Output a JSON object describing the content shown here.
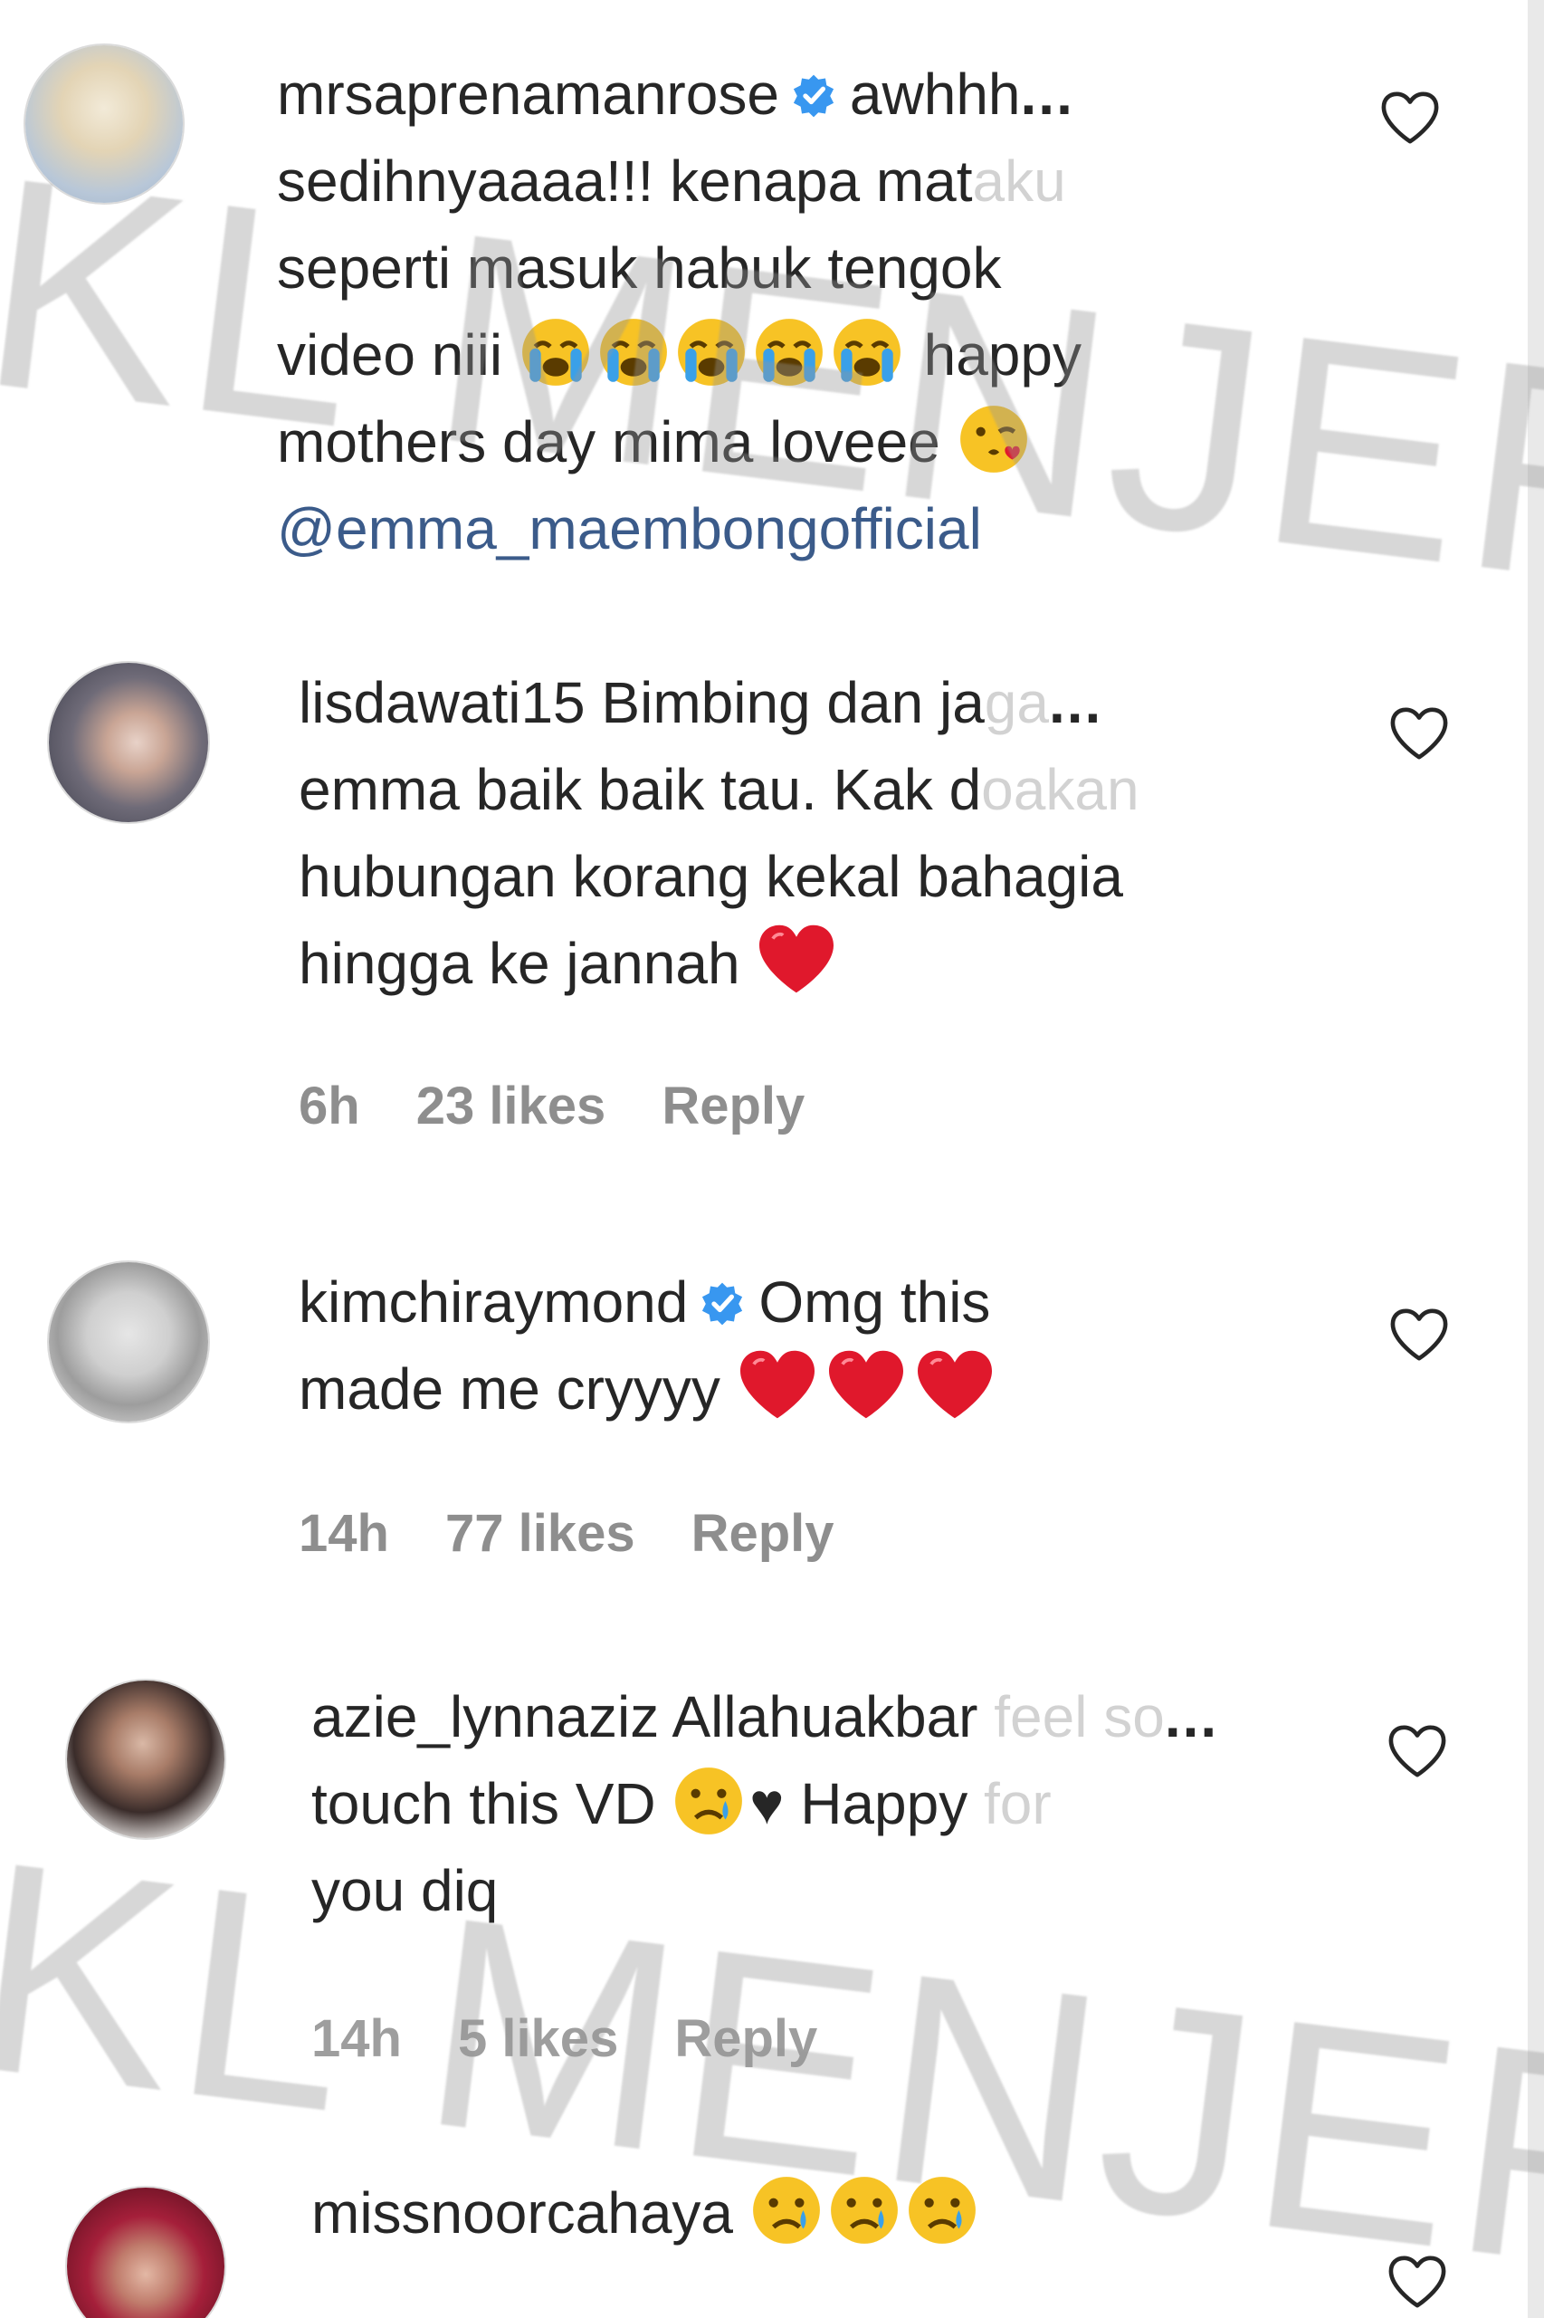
{
  "watermark": "KL MENJERIT",
  "more_label": "...",
  "colors": {
    "verified": "#3897f0",
    "mention": "#3b5b8a",
    "meta": "#8e8e8e",
    "heart_red": "#e0182c"
  },
  "comments": [
    {
      "username": "mrsaprenamanrose",
      "verified": true,
      "lines": [
        "awhhh",
        "sedihnyaaaa!!! kenapa mat",
        "aku",
        "sepe",
        "rti masuk habuk tengok",
        "video niii",
        "happy",
        "mothers day mima loveee"
      ],
      "mention": "@emma_maembongofficial",
      "emoji": [
        "crying-face-emoji",
        "crying-face-emoji",
        "crying-face-emoji",
        "crying-face-emoji",
        "crying-face-emoji",
        "kissing-wink-face-emoji"
      ]
    },
    {
      "username": "lisdawati15",
      "verified": false,
      "lines": [
        "Bimbing dan ja",
        "ga",
        "emma baik baik tau. Kak d",
        "oakan",
        "hubungan korang kekal bahagia",
        "hingga ke jannah"
      ],
      "meta": {
        "time": "6h",
        "likes": "23 likes",
        "reply": "Reply"
      },
      "emoji": [
        "red-heart-emoji"
      ]
    },
    {
      "username": "kimchiraymond",
      "verified": true,
      "lines": [
        "Omg this",
        "made me cryyyy"
      ],
      "meta": {
        "time": "14h",
        "likes": "77 likes",
        "reply": "Reply"
      },
      "emoji": [
        "red-heart-emoji",
        "red-heart-emoji",
        "red-heart-emoji"
      ]
    },
    {
      "username": "azie_lynnaziz",
      "verified": false,
      "lines": [
        "Allahuakbar",
        "feel so",
        "touch this VD",
        "♥ Happy",
        "for",
        "you diq"
      ],
      "meta": {
        "time": "14h",
        "likes": "5 likes",
        "reply": "Reply"
      },
      "emoji": [
        "crying-face-emoji"
      ]
    },
    {
      "username": "missnoorcahaya",
      "verified": false,
      "lines": [],
      "emoji": [
        "crying-face-emoji",
        "crying-face-emoji",
        "crying-face-emoji"
      ]
    }
  ]
}
